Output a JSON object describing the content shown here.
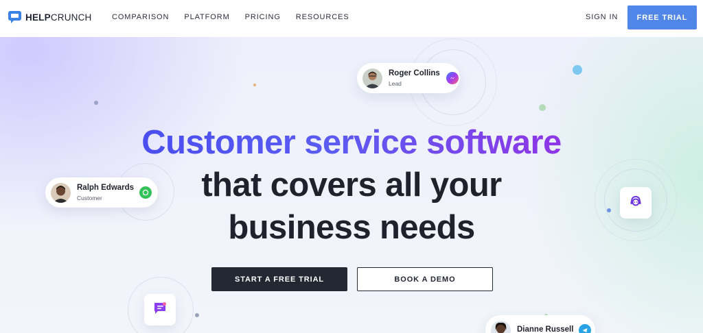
{
  "header": {
    "logo_bold": "HELP",
    "logo_light": "CRUNCH",
    "nav": [
      {
        "label": "COMPARISON"
      },
      {
        "label": "PLATFORM"
      },
      {
        "label": "PRICING"
      },
      {
        "label": "RESOURCES"
      }
    ],
    "sign_in": "SIGN IN",
    "free_trial": "FREE TRIAL"
  },
  "hero": {
    "headline_line1": "Customer service software",
    "headline_line2": "that covers all your",
    "headline_line3": "business needs",
    "cta_primary": "START A FREE TRIAL",
    "cta_secondary": "BOOK A DEMO"
  },
  "cards": [
    {
      "name": "Roger Collins",
      "role": "Lead",
      "channel_icon": "messenger-icon"
    },
    {
      "name": "Ralph Edwards",
      "role": "Customer",
      "channel_icon": "whatsapp-icon"
    },
    {
      "name": "Dianne Russell",
      "role": "",
      "channel_icon": "telegram-icon"
    }
  ],
  "colors": {
    "accent_blue": "#4f86e8",
    "dark": "#232833",
    "headline_gradient_start": "#4b4ef0",
    "headline_gradient_end": "#8f36e6"
  }
}
